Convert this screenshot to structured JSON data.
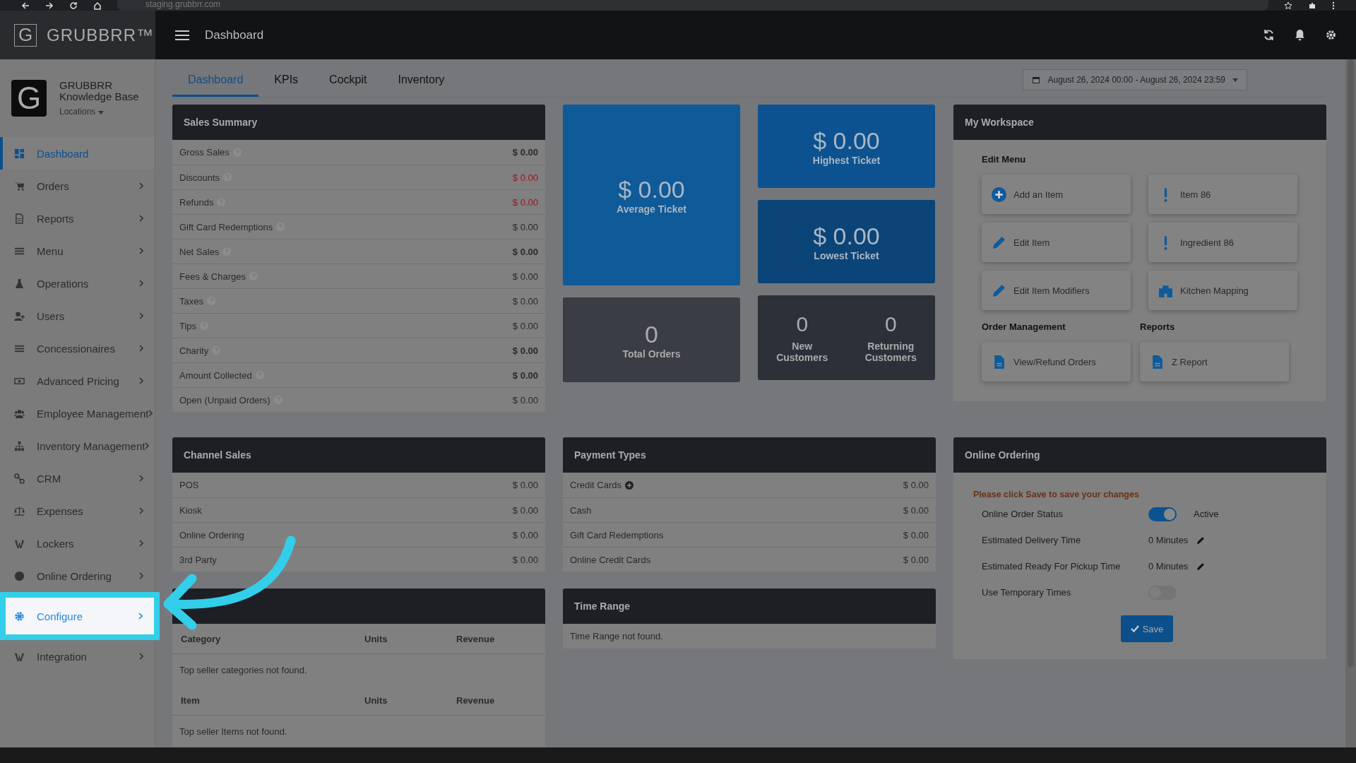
{
  "browser": {
    "url": "staging.grubbrr.com"
  },
  "topbar": {
    "brand": "GRUBBRR™",
    "brand_letter": "G",
    "title": "Dashboard"
  },
  "profile": {
    "letter": "G",
    "name": "GRUBBRR",
    "subtitle": "Knowledge Base",
    "locations": "Locations"
  },
  "sidebar": {
    "items": [
      {
        "label": "Dashboard",
        "selected": true,
        "highlighted": false,
        "expandable": false
      },
      {
        "label": "Orders",
        "selected": false,
        "highlighted": false,
        "expandable": true
      },
      {
        "label": "Reports",
        "selected": false,
        "highlighted": false,
        "expandable": true
      },
      {
        "label": "Menu",
        "selected": false,
        "highlighted": false,
        "expandable": true
      },
      {
        "label": "Operations",
        "selected": false,
        "highlighted": false,
        "expandable": true
      },
      {
        "label": "Users",
        "selected": false,
        "highlighted": false,
        "expandable": true
      },
      {
        "label": "Concessionaires",
        "selected": false,
        "highlighted": false,
        "expandable": true
      },
      {
        "label": "Advanced Pricing",
        "selected": false,
        "highlighted": false,
        "expandable": true
      },
      {
        "label": "Employee Management",
        "selected": false,
        "highlighted": false,
        "expandable": true
      },
      {
        "label": "Inventory Management",
        "selected": false,
        "highlighted": false,
        "expandable": true
      },
      {
        "label": "CRM",
        "selected": false,
        "highlighted": false,
        "expandable": true
      },
      {
        "label": "Expenses",
        "selected": false,
        "highlighted": false,
        "expandable": true
      },
      {
        "label": "Lockers",
        "selected": false,
        "highlighted": false,
        "expandable": true
      },
      {
        "label": "Online Ordering",
        "selected": false,
        "highlighted": false,
        "expandable": true
      },
      {
        "label": "Configure",
        "selected": false,
        "highlighted": true,
        "expandable": true
      },
      {
        "label": "Integration",
        "selected": false,
        "highlighted": false,
        "expandable": true
      }
    ]
  },
  "tabs": [
    {
      "label": "Dashboard",
      "selected": true
    },
    {
      "label": "KPIs",
      "selected": false
    },
    {
      "label": "Cockpit",
      "selected": false
    },
    {
      "label": "Inventory",
      "selected": false
    }
  ],
  "date_range": "August 26, 2024 00:00 - August 26, 2024 23:59",
  "sales_summary": {
    "title": "Sales Summary",
    "rows": [
      {
        "label": "Gross Sales",
        "value": "$ 0.00",
        "kind": "total"
      },
      {
        "label": "Discounts",
        "value": "$ 0.00",
        "kind": "deduction"
      },
      {
        "label": "Refunds",
        "value": "$ 0.00",
        "kind": "deduction"
      },
      {
        "label": "Gift Card Redemptions",
        "value": "$ 0.00",
        "kind": "plain"
      },
      {
        "label": "Net Sales",
        "value": "$ 0.00",
        "kind": "total"
      },
      {
        "label": "Fees & Charges",
        "value": "$ 0.00",
        "kind": "plain"
      },
      {
        "label": "Taxes",
        "value": "$ 0.00",
        "kind": "plain"
      },
      {
        "label": "Tips",
        "value": "$ 0.00",
        "kind": "plain"
      },
      {
        "label": "Charity",
        "value": "$ 0.00",
        "kind": "total"
      },
      {
        "label": "Amount Collected",
        "value": "$ 0.00",
        "kind": "total"
      },
      {
        "label": "Open (Unpaid Orders)",
        "value": "$ 0.00",
        "kind": "plain"
      }
    ]
  },
  "tile_columns": [
    [
      {
        "kind": "single",
        "color": "#0f5a98",
        "stats": [
          {
            "value": "$ 0.00",
            "label": "Average Ticket"
          }
        ]
      },
      {
        "kind": "single",
        "color": "#3a3d44",
        "stats": [
          {
            "value": "0",
            "label": "Total Orders"
          }
        ]
      }
    ],
    [
      {
        "kind": "single",
        "color": "#0d5290",
        "stats": [
          {
            "value": "$ 0.00",
            "label": "Highest Ticket"
          }
        ]
      },
      {
        "kind": "single",
        "color": "#0b4477",
        "stats": [
          {
            "value": "$ 0.00",
            "label": "Lowest Ticket"
          }
        ]
      },
      {
        "kind": "pair",
        "color": "#2c3039",
        "stats": [
          {
            "value": "0",
            "label": "New Customers"
          },
          {
            "value": "0",
            "label": "Returning Customers"
          }
        ]
      }
    ]
  ],
  "workspace": {
    "title": "My Workspace",
    "sections": [
      {
        "title": "Edit Menu",
        "items": [
          {
            "label": "Add an Item",
            "kind": "add"
          },
          {
            "label": "Item 86",
            "kind": "alert"
          },
          {
            "label": "Edit Item",
            "kind": "edit"
          },
          {
            "label": "Ingredient 86",
            "kind": "alert"
          },
          {
            "label": "Edit Item Modifiers",
            "kind": "edit"
          },
          {
            "label": "Kitchen Mapping",
            "kind": "mapping"
          }
        ]
      },
      {
        "title": "Order Management",
        "items": [
          {
            "label": "View/Refund Orders",
            "kind": "document"
          }
        ]
      },
      {
        "title": "Reports",
        "items": [
          {
            "label": "Z Report",
            "kind": "document"
          }
        ]
      }
    ]
  },
  "channel_sales": {
    "title": "Channel Sales",
    "rows": [
      {
        "label": "POS",
        "value": "$ 0.00"
      },
      {
        "label": "Kiosk",
        "value": "$ 0.00"
      },
      {
        "label": "Online Ordering",
        "value": "$ 0.00"
      },
      {
        "label": "3rd Party",
        "value": "$ 0.00"
      }
    ]
  },
  "payment_types": {
    "title": "Payment Types",
    "rows": [
      {
        "label": "Credit Cards",
        "value": "$ 0.00",
        "kind": "expandable"
      },
      {
        "label": "Cash",
        "value": "$ 0.00",
        "kind": "plain"
      },
      {
        "label": "Gift Card Redemptions",
        "value": "$ 0.00",
        "kind": "plain"
      },
      {
        "label": "Online Credit Cards",
        "value": "$ 0.00",
        "kind": "plain"
      }
    ]
  },
  "online_ordering": {
    "title": "Online Ordering",
    "note": "Please click Save to save your changes",
    "rows": [
      {
        "label": "Online Order Status",
        "kind": "toggle",
        "on": true,
        "value": "Active"
      },
      {
        "label": "Estimated Delivery Time",
        "kind": "editable",
        "value": "0 Minutes"
      },
      {
        "label": "Estimated Ready For Pickup Time",
        "kind": "editable",
        "value": "0 Minutes"
      },
      {
        "label": "Use Temporary Times",
        "kind": "toggle",
        "on": false
      }
    ],
    "save": "Save"
  },
  "top_sellers": {
    "tables": [
      {
        "columns": [
          "Category",
          "Units",
          "Revenue"
        ],
        "empty": "Top seller categories not found."
      },
      {
        "columns": [
          "Item",
          "Units",
          "Revenue"
        ],
        "empty": "Top seller Items not found."
      }
    ]
  },
  "time_range": {
    "title": "Time Range",
    "empty": "Time Range not found."
  }
}
